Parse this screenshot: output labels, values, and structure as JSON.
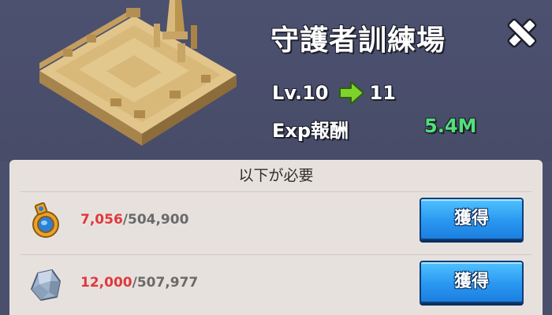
{
  "header": {
    "title": "守護者訓練場",
    "close_icon": "close-x-icon"
  },
  "level": {
    "current": "Lv.10",
    "next": "11",
    "arrow_icon": "green-arrow-right-icon"
  },
  "reward": {
    "label": "Exp報酬",
    "value": "5.4M"
  },
  "requirements": {
    "header": "以下が必要",
    "items": [
      {
        "icon": "gold-ring-medal-icon",
        "have": "7,056",
        "need": "/504,900",
        "button_label": "獲得"
      },
      {
        "icon": "stone-ore-icon",
        "have": "12,000",
        "need": "/507,977",
        "button_label": "獲得"
      }
    ]
  },
  "colors": {
    "background": "#4a4f6b",
    "panel": "#e7e1de",
    "exp_value": "#52e07a",
    "insufficient": "#e0393b",
    "button": "#2a97f0"
  }
}
